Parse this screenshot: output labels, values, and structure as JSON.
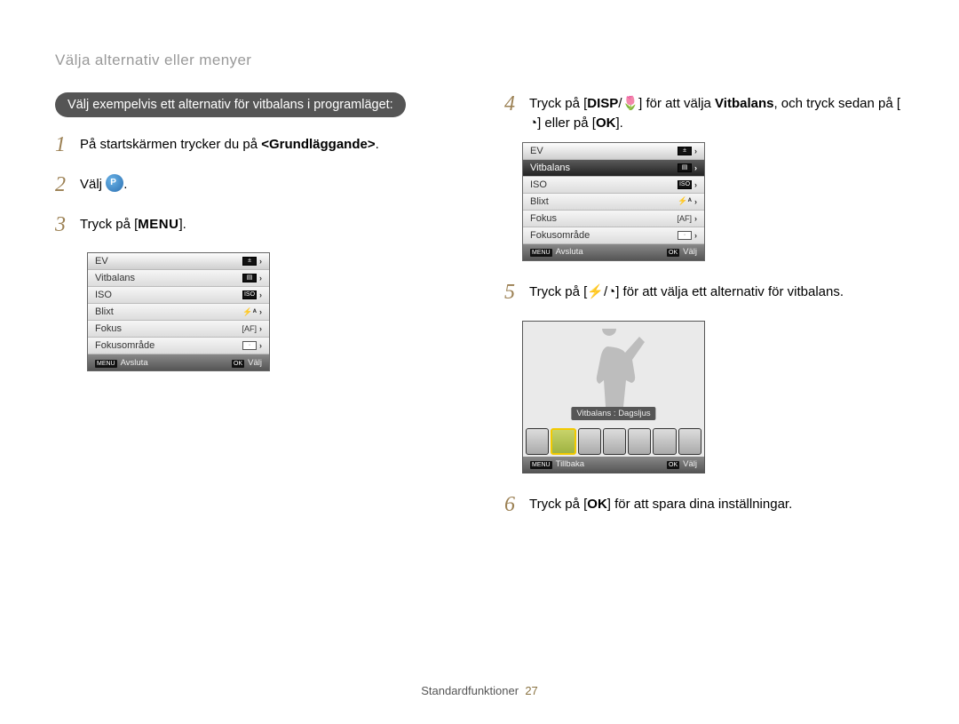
{
  "page_title": "Välja alternativ eller menyer",
  "pill_text": "Välj exempelvis ett alternativ för vitbalans i programläget:",
  "steps": {
    "s1_a": "På startskärmen trycker du på ",
    "s1_b": "<Grundläggande>",
    "s1_c": ".",
    "s2_a": "Välj ",
    "s3_a": "Tryck på [",
    "s3_b": "MENU",
    "s3_c": "].",
    "s4_a": "Tryck på [",
    "s4_b": "DISP",
    "s4_c": "/",
    "s4_d": "] för att välja ",
    "s4_e": "Vitbalans",
    "s4_f": ", och tryck sedan på [",
    "s4_g": "] eller på [",
    "s4_h": "OK",
    "s4_i": "].",
    "s5_a": "Tryck på [",
    "s5_b": "/",
    "s5_c": "] för att välja ett alternativ för vitbalans.",
    "s6_a": "Tryck på [",
    "s6_b": "OK",
    "s6_c": "] för att spara dina inställningar."
  },
  "menu_items": [
    "EV",
    "Vitbalans",
    "ISO",
    "Blixt",
    "Fokus",
    "Fokusområde"
  ],
  "menu_footer": {
    "left_btn": "MENU",
    "left_label": "Avsluta",
    "right_btn": "OK",
    "right_label": "Välj"
  },
  "wb": {
    "label": "Vitbalans : Dagsljus",
    "footer_left_btn": "MENU",
    "footer_left_label": "Tillbaka",
    "footer_right_btn": "OK",
    "footer_right_label": "Välj"
  },
  "footer": {
    "section": "Standardfunktioner",
    "page": "27"
  }
}
